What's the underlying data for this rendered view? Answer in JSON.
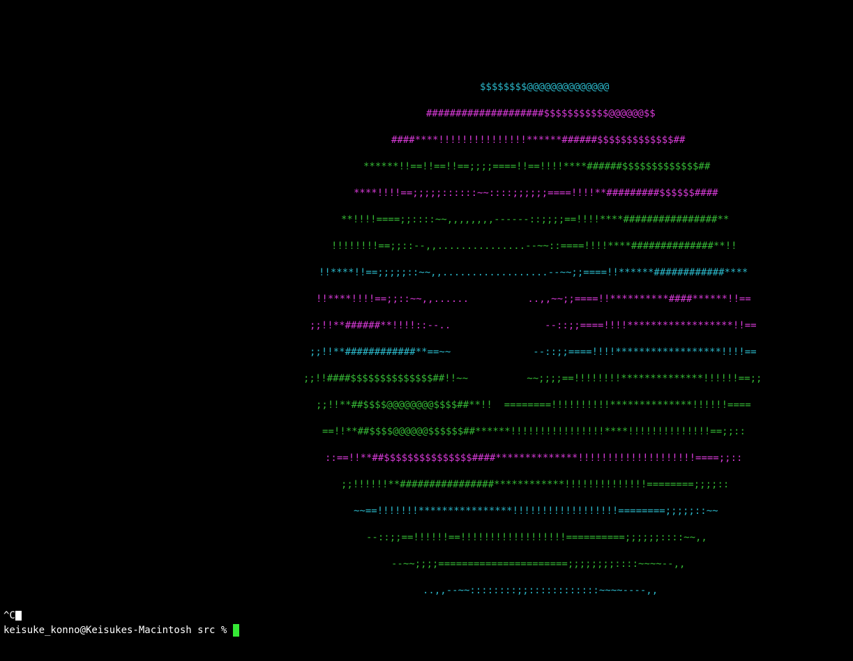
{
  "terminal": {
    "colors": {
      "background": "#000000",
      "cyan": "#2bb7c9",
      "magenta": "#d63ad6",
      "green": "#35b835",
      "cursor": "#35e835",
      "text": "#ffffff"
    },
    "art_lines": [
      {
        "text": "$$$$$$$$@@@@@@@@@@@@@@",
        "color": "cyan"
      },
      {
        "text": "####################$$$$$$$$$$$@@@@@@$$",
        "color": "magenta"
      },
      {
        "text": "####****!!!!!!!!!!!!!!!******######$$$$$$$$$$$$$##",
        "color": "magenta"
      },
      {
        "text": "******!!==!!==!!==;;;;====!!==!!!!****######$$$$$$$$$$$$$##",
        "color": "green"
      },
      {
        "text": "****!!!!==;;;;;::::::~~::::;;;;;;====!!!!**#########$$$$$$####",
        "color": "magenta"
      },
      {
        "text": "**!!!!====;;::::~~,,,,,,,,------::;;;;==!!!!****################**",
        "color": "green"
      },
      {
        "text": "!!!!!!!!==;;::--,,...............--~~::====!!!!****##############**!!",
        "color": "green"
      },
      {
        "text": "!!****!!==;;;;;::~~,,..................--~~;;====!!******############****",
        "color": "cyan"
      },
      {
        "text": "!!****!!!!==;;::~~,,......          ..,,~~;;====!!**********####******!!==",
        "color": "magenta"
      },
      {
        "text": ";;!!**######**!!!!::--..                --::;;====!!!!******************!!==",
        "color": "magenta"
      },
      {
        "text": ";;!!**############**==~~              --::;;====!!!!******************!!!!==",
        "color": "cyan"
      },
      {
        "text": ";;!!####$$$$$$$$$$$$$$##!!~~          ~~;;;;==!!!!!!!!**************!!!!!!==;;",
        "color": "green"
      },
      {
        "text": ";;!!**##$$$$@@@@@@@@$$$$##**!!  ========!!!!!!!!!!**************!!!!!!====",
        "color": "green"
      },
      {
        "text": "==!!**##$$$$@@@@@@$$$$$$##******!!!!!!!!!!!!!!!!****!!!!!!!!!!!!!!==;;::",
        "color": "green"
      },
      {
        "text": "::==!!**##$$$$$$$$$$$$$$$####**************!!!!!!!!!!!!!!!!!!!!====;;::",
        "color": "magenta"
      },
      {
        "text": ";;!!!!!!**################************!!!!!!!!!!!!!!========;;;;::",
        "color": "green"
      },
      {
        "text": "~~==!!!!!!!****************!!!!!!!!!!!!!!!!!!========;;;;;::~~",
        "color": "cyan"
      },
      {
        "text": "--::;;==!!!!!!==!!!!!!!!!!!!!!!!!!==========;;;;;;::::~~,,",
        "color": "green"
      },
      {
        "text": "--~~;;;;======================;;;;;;;;::::~~~~--,,",
        "color": "green"
      },
      {
        "text": "..,,--~~::::::::;;::::::::::::~~~~----,,",
        "color": "cyan"
      }
    ],
    "interrupt_text": "^C",
    "prompt": "keisuke_konno@Keisukes-Macintosh src % "
  }
}
